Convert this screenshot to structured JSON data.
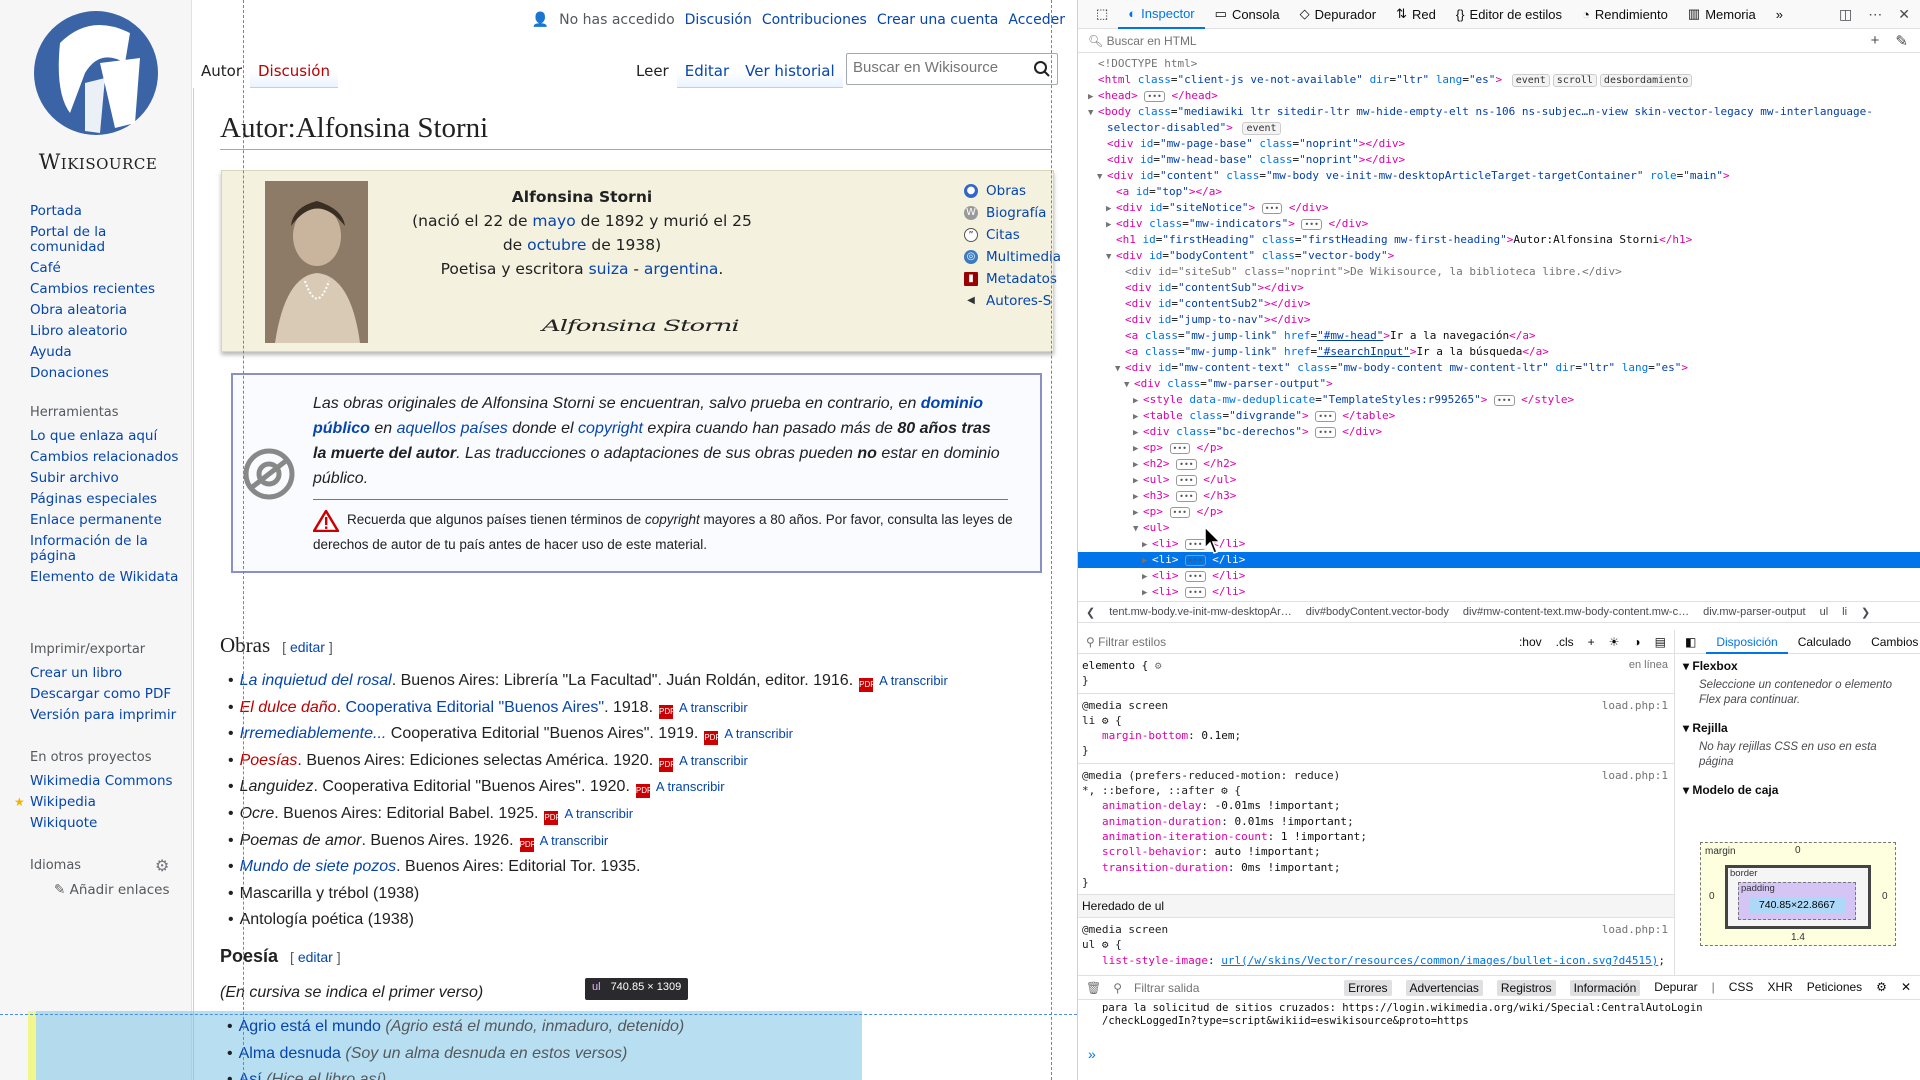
{
  "wiki": {
    "logo_text": "Wikisource",
    "personal": {
      "not_logged": "No has accedido",
      "discussion": "Discusión",
      "contributions": "Contribuciones",
      "create_account": "Crear una cuenta",
      "login": "Acceder"
    },
    "tabs_left": [
      "Autor",
      "Discusión"
    ],
    "tabs_right": [
      "Leer",
      "Editar",
      "Ver historial"
    ],
    "search_placeholder": "Buscar en Wikisource",
    "nav": {
      "items": [
        "Portada",
        "Portal de la comunidad",
        "Café",
        "Cambios recientes",
        "Obra aleatoria",
        "Libro aleatorio",
        "Ayuda",
        "Donaciones"
      ]
    },
    "tools": {
      "heading": "Herramientas",
      "items": [
        "Lo que enlaza aquí",
        "Cambios relacionados",
        "Subir archivo",
        "Páginas especiales",
        "Enlace permanente",
        "Información de la página",
        "Elemento de Wikidata"
      ]
    },
    "print": {
      "heading": "Imprimir/exportar",
      "items": [
        "Crear un libro",
        "Descargar como PDF",
        "Versión para imprimir"
      ]
    },
    "projects": {
      "heading": "En otros proyectos",
      "items": [
        "Wikimedia Commons",
        "Wikipedia",
        "Wikiquote"
      ]
    },
    "languages": {
      "heading": "Idiomas",
      "add_links": "Añadir enlaces"
    },
    "heading": "Autor:Alfonsina Storni",
    "author": {
      "name": "Alfonsina Storni",
      "born_prefix": "(nació el 22 de ",
      "born_month": "mayo",
      "born_mid": " de 1892 y murió el 25 de ",
      "died_month": "octubre",
      "died_suffix": " de 1938)",
      "desc_prefix": "Poetisa y escritora ",
      "nat1": "suiza",
      "sep": " - ",
      "nat2": "argentina",
      "desc_suffix": ".",
      "signature": "Alfonsina Storni",
      "links": [
        "Obras",
        "Biografía",
        "Citas",
        "Multimedia",
        "Metadatos",
        "Autores-S"
      ]
    },
    "pd": {
      "t1": "Las obras originales de Alfonsina Storni se encuentran, salvo prueba en contrario, en ",
      "l1": "dominio público",
      "t2": " en ",
      "l2": "aquellos países",
      "t3": " donde el ",
      "l3": "copyright",
      "t4": " expira cuando han pasado más de ",
      "b1": "80 años tras la muerte del autor",
      "t5": ". Las traducciones o adaptaciones de sus obras pueden ",
      "b2": "no",
      "t6": " estar en dominio público.",
      "w1": "Recuerda que algunos países tienen términos de ",
      "w_it": "copyright",
      "w2": " mayores a 80 años. Por favor, consulta las leyes de derechos de autor de tu país antes de hacer uso de este material."
    },
    "obras": {
      "heading": "Obras",
      "edit": "editar",
      "items": [
        {
          "title": "La inquietud del rosal",
          "rest": ". Buenos Aires: Librería \"La Facultad\". Juán Roldán, editor. 1916.",
          "pdf": "A transcribir"
        },
        {
          "title": "El dulce daño",
          "link": "Cooperativa Editorial \"Buenos Aires\"",
          "rest": ". 1918.",
          "pdf": "A transcribir"
        },
        {
          "title": "Irremediablemente...",
          "rest": " Cooperativa Editorial \"Buenos Aires\". 1919.",
          "pdf": "A transcribir"
        },
        {
          "title": "Poesías",
          "rest": ". Buenos Aires: Ediciones selectas América. 1920.",
          "pdf": "A transcribir"
        },
        {
          "title": "Languidez",
          "rest": ". Cooperativa Editorial \"Buenos Aires\". 1920.",
          "pdf": "A transcribir"
        },
        {
          "title": "Ocre",
          "rest": ". Buenos Aires: Editorial Babel. 1925.",
          "pdf": "A transcribir"
        },
        {
          "title": "Poemas de amor",
          "rest": ". Buenos Aires. 1926.",
          "pdf": "A transcribir"
        },
        {
          "title": "Mundo de siete pozos",
          "rest": ". Buenos Aires: Editorial Tor. 1935."
        },
        {
          "plain": "Mascarilla y trébol (1938)"
        },
        {
          "plain": "Antología poética (1938)"
        }
      ]
    },
    "poesia": {
      "heading": "Poesía",
      "edit": "editar",
      "note": "(En cursiva se indica el primer verso)",
      "items": [
        {
          "title": "Agrio está el mundo",
          "first": "(Agrio está el mundo, inmaduro, detenido)"
        },
        {
          "title": "Alma desnuda",
          "first": "(Soy un alma desnuda en estos versos)"
        },
        {
          "title": "Así",
          "first": "(Hice el libro así)"
        }
      ]
    },
    "highlight_tooltip": {
      "tag": "ul",
      "size": "740.85 × 1309"
    }
  },
  "devtools": {
    "tabs": [
      "Inspector",
      "Consola",
      "Depurador",
      "Red",
      "Editor de estilos",
      "Rendimiento",
      "Memoria"
    ],
    "active_tab": "Inspector",
    "html_search_placeholder": "Buscar en HTML",
    "markup": [
      {
        "indent": 0,
        "html": "<span class='cmt'>&lt;!DOCTYPE html&gt;</span>"
      },
      {
        "indent": 0,
        "tw": "",
        "html": "<span class='tag'>&lt;html</span> <span class='an'>class</span>=<span class='av'>\"client-js ve-not-available\"</span> <span class='an'>dir</span>=<span class='av'>\"ltr\"</span> <span class='an'>lang</span>=<span class='av'>\"es\"</span><span class='tag'>&gt;</span> <span class='badge'>event</span><span class='badge'>scroll</span><span class='badge'>desbordamiento</span>"
      },
      {
        "indent": 0,
        "tw": "▶",
        "html": "<span class='tag'>&lt;head&gt;</span> <span class='ell'>•••</span> <span class='tag'>&lt;/head&gt;</span>"
      },
      {
        "indent": 0,
        "tw": "▼",
        "html": "<span class='tag'>&lt;body</span> <span class='an'>class</span>=<span class='av'>\"mediawiki ltr sitedir-ltr mw-hide-empty-elt ns-106 ns-subjec…n-view skin-vector-legacy mw-interlanguage-</span>"
      },
      {
        "indent": 1,
        "html": "<span class='av'>selector-disabled\"</span><span class='tag'>&gt;</span> <span class='badge'>event</span>"
      },
      {
        "indent": 1,
        "html": "<span class='tag'>&lt;div</span> <span class='an'>id</span>=<span class='av'>\"mw-page-base\"</span> <span class='an'>class</span>=<span class='av'>\"noprint\"</span><span class='tag'>&gt;&lt;/div&gt;</span>"
      },
      {
        "indent": 1,
        "html": "<span class='tag'>&lt;div</span> <span class='an'>id</span>=<span class='av'>\"mw-head-base\"</span> <span class='an'>class</span>=<span class='av'>\"noprint\"</span><span class='tag'>&gt;&lt;/div&gt;</span>"
      },
      {
        "indent": 1,
        "tw": "▼",
        "html": "<span class='tag'>&lt;div</span> <span class='an'>id</span>=<span class='av'>\"content\"</span> <span class='an'>class</span>=<span class='av'>\"mw-body ve-init-mw-desktopArticleTarget-targetContainer\"</span> <span class='an'>role</span>=<span class='av'>\"main\"</span><span class='tag'>&gt;</span>"
      },
      {
        "indent": 2,
        "html": "<span class='tag'>&lt;a</span> <span class='an'>id</span>=<span class='av'>\"top\"</span><span class='tag'>&gt;&lt;/a&gt;</span>"
      },
      {
        "indent": 2,
        "tw": "▶",
        "html": "<span class='tag'>&lt;div</span> <span class='an'>id</span>=<span class='av'>\"siteNotice\"</span><span class='tag'>&gt;</span> <span class='ell'>•••</span> <span class='tag'>&lt;/div&gt;</span>"
      },
      {
        "indent": 2,
        "tw": "▶",
        "html": "<span class='tag'>&lt;div</span> <span class='an'>class</span>=<span class='av'>\"mw-indicators\"</span><span class='tag'>&gt;</span> <span class='ell'>•••</span> <span class='tag'>&lt;/div&gt;</span>"
      },
      {
        "indent": 2,
        "html": "<span class='tag'>&lt;h1</span> <span class='an'>id</span>=<span class='av'>\"firstHeading\"</span> <span class='an'>class</span>=<span class='av'>\"firstHeading mw-first-heading\"</span><span class='tag'>&gt;</span>Autor:Alfonsina Storni<span class='tag'>&lt;/h1&gt;</span>"
      },
      {
        "indent": 2,
        "tw": "▼",
        "html": "<span class='tag'>&lt;div</span> <span class='an'>id</span>=<span class='av'>\"bodyContent\"</span> <span class='an'>class</span>=<span class='av'>\"vector-body\"</span><span class='tag'>&gt;</span>"
      },
      {
        "indent": 3,
        "html": "<span class='cmt'>&lt;div id=\"siteSub\" class=\"noprint\"&gt;De Wikisource, la biblioteca libre.&lt;/div&gt;</span>"
      },
      {
        "indent": 3,
        "html": "<span class='tag'>&lt;div</span> <span class='an'>id</span>=<span class='av'>\"contentSub\"</span><span class='tag'>&gt;&lt;/div&gt;</span>"
      },
      {
        "indent": 3,
        "html": "<span class='tag'>&lt;div</span> <span class='an'>id</span>=<span class='av'>\"contentSub2\"</span><span class='tag'>&gt;&lt;/div&gt;</span>"
      },
      {
        "indent": 3,
        "html": "<span class='tag'>&lt;div</span> <span class='an'>id</span>=<span class='av'>\"jump-to-nav\"</span><span class='tag'>&gt;&lt;/div&gt;</span>"
      },
      {
        "indent": 3,
        "html": "<span class='tag'>&lt;a</span> <span class='an'>class</span>=<span class='av'>\"mw-jump-link\"</span> <span class='an'>href</span>=<span class='av'><u>\"#mw-head\"</u></span><span class='tag'>&gt;</span>Ir a la navegación<span class='tag'>&lt;/a&gt;</span>"
      },
      {
        "indent": 3,
        "html": "<span class='tag'>&lt;a</span> <span class='an'>class</span>=<span class='av'>\"mw-jump-link\"</span> <span class='an'>href</span>=<span class='av'><u>\"#searchInput\"</u></span><span class='tag'>&gt;</span>Ir a la búsqueda<span class='tag'>&lt;/a&gt;</span>"
      },
      {
        "indent": 3,
        "tw": "▼",
        "html": "<span class='tag'>&lt;div</span> <span class='an'>id</span>=<span class='av'>\"mw-content-text\"</span> <span class='an'>class</span>=<span class='av'>\"mw-body-content mw-content-ltr\"</span> <span class='an'>dir</span>=<span class='av'>\"ltr\"</span> <span class='an'>lang</span>=<span class='av'>\"es\"</span><span class='tag'>&gt;</span>"
      },
      {
        "indent": 4,
        "tw": "▼",
        "html": "<span class='tag'>&lt;div</span> <span class='an'>class</span>=<span class='av'>\"mw-parser-output\"</span><span class='tag'>&gt;</span>"
      },
      {
        "indent": 5,
        "tw": "▶",
        "html": "<span class='tag'>&lt;style</span> <span class='an'>data-mw-deduplicate</span>=<span class='av'>\"TemplateStyles:r995265\"</span><span class='tag'>&gt;</span> <span class='ell'>•••</span> <span class='tag'>&lt;/style&gt;</span>"
      },
      {
        "indent": 5,
        "tw": "▶",
        "html": "<span class='tag'>&lt;table</span> <span class='an'>class</span>=<span class='av'>\"divgrande\"</span><span class='tag'>&gt;</span> <span class='ell'>•••</span> <span class='tag'>&lt;/table&gt;</span>"
      },
      {
        "indent": 5,
        "tw": "▶",
        "html": "<span class='tag'>&lt;div</span> <span class='an'>class</span>=<span class='av'>\"bc-derechos\"</span><span class='tag'>&gt;</span> <span class='ell'>•••</span> <span class='tag'>&lt;/div&gt;</span>"
      },
      {
        "indent": 5,
        "tw": "▶",
        "html": "<span class='tag'>&lt;p&gt;</span> <span class='ell'>•••</span> <span class='tag'>&lt;/p&gt;</span>"
      },
      {
        "indent": 5,
        "tw": "▶",
        "html": "<span class='tag'>&lt;h2&gt;</span> <span class='ell'>•••</span> <span class='tag'>&lt;/h2&gt;</span>"
      },
      {
        "indent": 5,
        "tw": "▶",
        "html": "<span class='tag'>&lt;ul&gt;</span> <span class='ell'>•••</span> <span class='tag'>&lt;/ul&gt;</span>"
      },
      {
        "indent": 5,
        "tw": "▶",
        "html": "<span class='tag'>&lt;h3&gt;</span> <span class='ell'>•••</span> <span class='tag'>&lt;/h3&gt;</span>"
      },
      {
        "indent": 5,
        "tw": "▶",
        "html": "<span class='tag'>&lt;p&gt;</span> <span class='ell'>•••</span> <span class='tag'>&lt;/p&gt;</span>"
      },
      {
        "indent": 5,
        "tw": "▼",
        "html": "<span class='tag'>&lt;ul&gt;</span>"
      },
      {
        "indent": 6,
        "tw": "▶",
        "html": "<span class='tag'>&lt;li&gt;</span> <span class='ell'>•••</span> <span class='tag'>&lt;/li&gt;</span>"
      },
      {
        "indent": 6,
        "tw": "▶",
        "sel": true,
        "html": "<span class='tag'>&lt;li&gt;</span> <span class='ell'>•••</span> <span class='tag'>&lt;/li&gt;</span>"
      },
      {
        "indent": 6,
        "tw": "▶",
        "html": "<span class='tag'>&lt;li&gt;</span> <span class='ell'>•••</span> <span class='tag'>&lt;/li&gt;</span>"
      },
      {
        "indent": 6,
        "tw": "▶",
        "html": "<span class='tag'>&lt;li&gt;</span> <span class='ell'>•••</span> <span class='tag'>&lt;/li&gt;</span>"
      }
    ],
    "breadcrumbs": [
      "tent.mw-body.ve-init-mw-desktopAr…",
      "div#bodyContent.vector-body",
      "div#mw-content-text.mw-body-content.mw-c…",
      "div.mw-parser-output",
      "ul",
      "li"
    ],
    "rules": {
      "filter_placeholder": "Filtrar estilos",
      "hov": ":hov",
      "cls": ".cls",
      "element_label": "elemento {",
      "inline": "en línea",
      "source": "load.php:1",
      "media_screen": "@media screen",
      "media_reduced": "@media (prefers-reduced-motion: reduce)",
      "li_selector": "li",
      "li_props": [
        {
          "n": "margin-bottom",
          "v": "0.1em"
        }
      ],
      "star_selector": "*, ::before, ::after",
      "star_props": [
        {
          "n": "animation-delay",
          "v": "-0.01ms !important"
        },
        {
          "n": "animation-duration",
          "v": "0.01ms !important"
        },
        {
          "n": "animation-iteration-count",
          "v": "1 !important"
        },
        {
          "n": "scroll-behavior",
          "v": "auto !important"
        },
        {
          "n": "transition-duration",
          "v": "0ms !important"
        }
      ],
      "inherited": "Heredado de ul",
      "ul_selector": "ul",
      "ul_prop_name": "list-style-image",
      "ul_prop_url": "url(/w/skins/Vector/resources/common/images/bullet-icon.svg?d4515)"
    },
    "layout": {
      "tabs": [
        "Disposición",
        "Calculado",
        "Cambios"
      ],
      "flex_heading": "Flexbox",
      "flex_text": "Seleccione un contenedor o elemento Flex para continuar.",
      "grid_heading": "Rejilla",
      "grid_text": "No hay rejillas CSS en uso en esta página",
      "box_heading": "Modelo de caja",
      "margin": "margin",
      "border": "border",
      "padding": "padding",
      "content_size": "740.85×22.8667",
      "zero": "0",
      "margin_bottom": "1.4"
    },
    "console": {
      "filter_placeholder": "Filtrar salida",
      "filters": [
        "Errores",
        "Advertencias",
        "Registros",
        "Información",
        "Depurar",
        "CSS",
        "XHR",
        "Peticiones"
      ],
      "line1": "para la solicitud de sitios cruzados: https://login.wikimedia.org/wiki/Special:CentralAutoLogin",
      "line2": "/checkLoggedIn?type=script&wikiid=eswikisource&proto=https",
      "prompt": "»"
    }
  }
}
